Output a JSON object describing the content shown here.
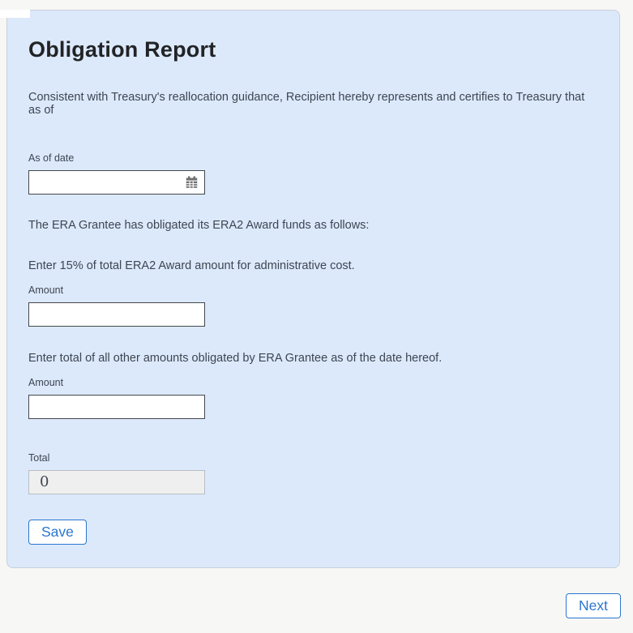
{
  "panel": {
    "title": "Obligation Report",
    "intro": "Consistent with Treasury's reallocation guidance, Recipient hereby represents and certifies to Treasury that as of",
    "obligated_text": "The ERA Grantee has obligated its ERA2 Award funds as follows:",
    "admin_instruction": "Enter 15% of total ERA2 Award amount for administrative cost.",
    "other_instruction": "Enter total of all other amounts obligated by ERA Grantee as of the date hereof."
  },
  "fields": {
    "as_of_date": {
      "label": "As of date",
      "value": ""
    },
    "admin_amount": {
      "label": "Amount",
      "value": ""
    },
    "other_amount": {
      "label": "Amount",
      "value": ""
    },
    "total": {
      "label": "Total",
      "value": "0"
    }
  },
  "buttons": {
    "save": "Save",
    "next": "Next"
  },
  "icons": {
    "calendar": "calendar-icon"
  },
  "colors": {
    "panel_bg": "#dce9fb",
    "page_bg": "#f7f7f5",
    "accent_blue": "#2b76cf",
    "input_border": "#44474d",
    "body_text": "#3d4551",
    "icon_gray": "#6f6f6f"
  }
}
